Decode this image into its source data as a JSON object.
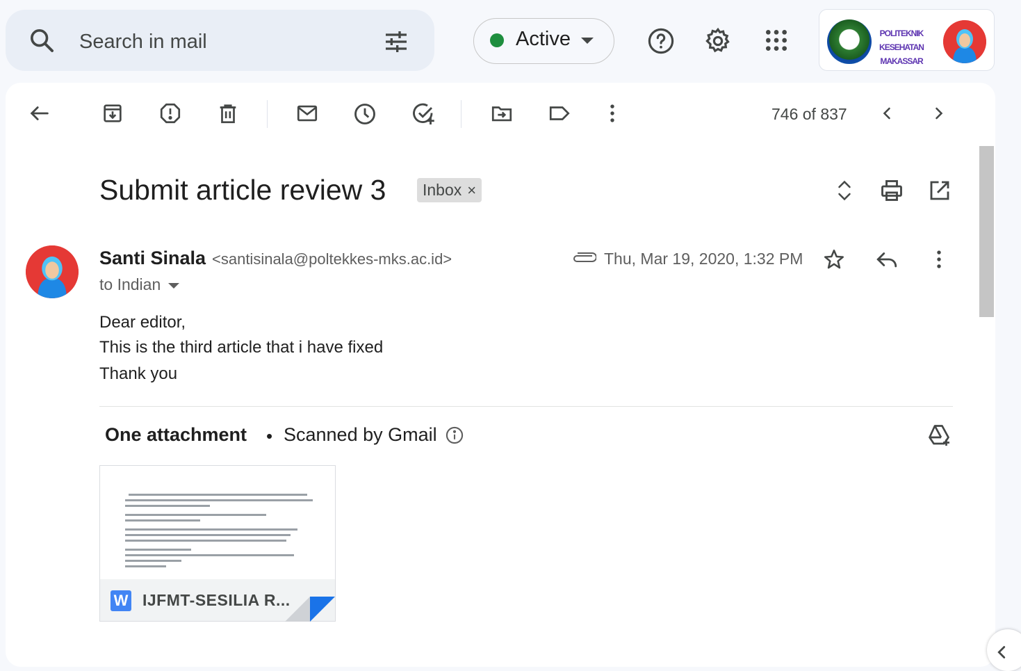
{
  "search": {
    "placeholder": "Search in mail"
  },
  "status": {
    "label": "Active",
    "color": "#1e8e3e"
  },
  "header_icons": [
    "help-icon",
    "settings-icon",
    "apps-icon"
  ],
  "account": {
    "org_line1": "POLITEKNIK KESEHATAN",
    "org_line2": "MAKASSAR"
  },
  "toolbar": {
    "icons": [
      "back-arrow-icon",
      "archive-icon",
      "report-spam-icon",
      "delete-icon",
      "mark-unread-icon",
      "snooze-icon",
      "add-task-icon",
      "move-to-icon",
      "label-icon",
      "more-vert-icon"
    ],
    "page_counter": "746 of 837"
  },
  "message": {
    "subject": "Submit article review 3",
    "label_chip": "Inbox",
    "sender_name": "Santi Sinala",
    "sender_email": "<santisinala@poltekkes-mks.ac.id>",
    "recipient": "to Indian",
    "date": "Thu, Mar 19, 2020, 1:32 PM",
    "body": [
      "Dear editor,",
      "This is the third article that i have fixed",
      "Thank you"
    ]
  },
  "attachments": {
    "title": "One attachment",
    "separator": "•",
    "scanned": "Scanned by Gmail",
    "file_name": "IJFMT-SESILIA R...",
    "file_type_letter": "W"
  }
}
